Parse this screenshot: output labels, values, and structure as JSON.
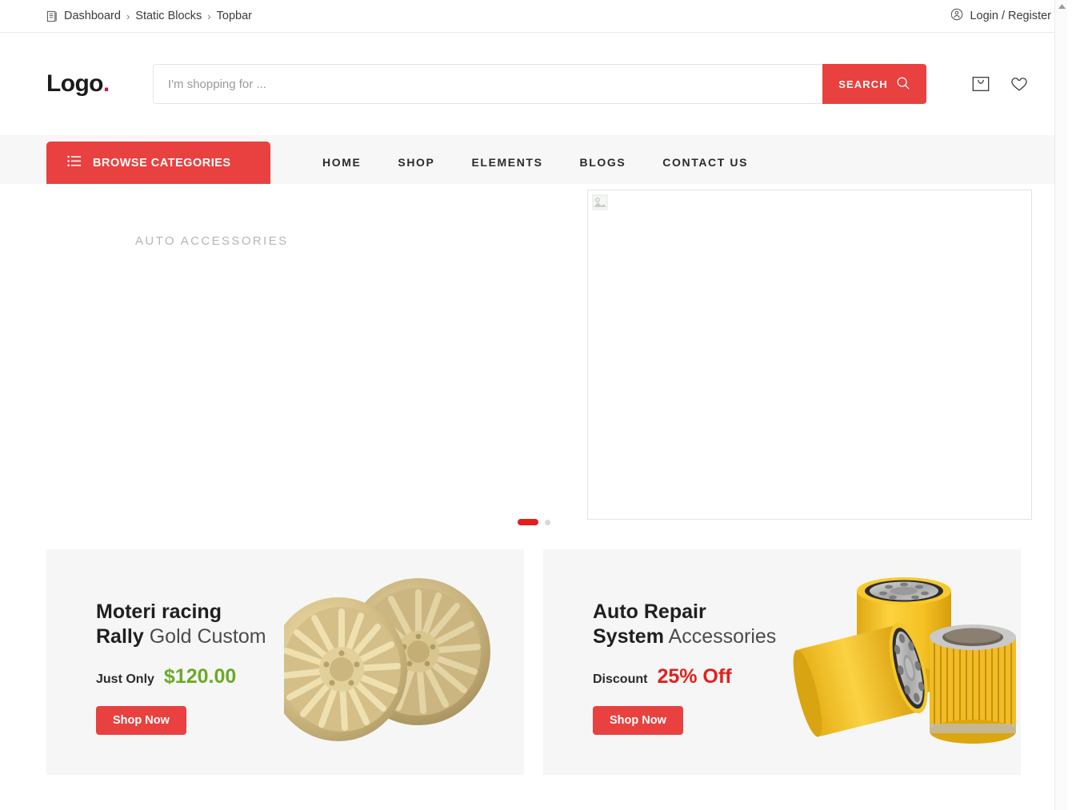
{
  "topbar": {
    "breadcrumb_icon": "block-icon",
    "breadcrumb": [
      {
        "label": "Dashboard"
      },
      {
        "label": "Static Blocks"
      },
      {
        "label": "Topbar"
      }
    ],
    "separator": "›",
    "account_icon": "user-circle-icon",
    "account_label": "Login / Register"
  },
  "header": {
    "logo_text": "Logo",
    "logo_dot": ".",
    "search": {
      "placeholder": "I'm shopping for ...",
      "value": "",
      "button_label": "SEARCH",
      "button_icon": "search-icon"
    },
    "icons": [
      {
        "name": "cart-icon"
      },
      {
        "name": "wishlist-heart-icon"
      }
    ]
  },
  "nav": {
    "browse_icon": "list-menu-icon",
    "browse_label": "BROWSE CATEGORIES",
    "links": [
      {
        "label": "HOME"
      },
      {
        "label": "SHOP"
      },
      {
        "label": "ELEMENTS"
      },
      {
        "label": "BLOGS"
      },
      {
        "label": "CONTACT US"
      }
    ]
  },
  "hero": {
    "caption": "AUTO ACCESSORIES",
    "image_placeholder_icon": "broken-image-icon",
    "dots": [
      {
        "state": "active"
      },
      {
        "state": "idle"
      }
    ]
  },
  "promos": [
    {
      "title_bold_1": "Moteri racing",
      "title_bold_2": "Rally",
      "title_light": "Gold Custom",
      "price_label": "Just Only",
      "price_value": "$120.00",
      "price_color": "#6aab26",
      "button_label": "Shop Now",
      "image": "gold-alloy-wheels"
    },
    {
      "title_bold_1": "Auto Repair",
      "title_bold_2": "System",
      "title_light": "Accessories",
      "price_label": "Discount",
      "price_value": "25% Off",
      "price_color": "#e2211c",
      "button_label": "Shop Now",
      "image": "yellow-oil-filters"
    }
  ],
  "colors": {
    "accent_red": "#e8413f",
    "price_green": "#6aab26",
    "price_red": "#e2211c",
    "nav_bg": "#f7f7f7",
    "promo_bg": "#f6f6f6"
  }
}
